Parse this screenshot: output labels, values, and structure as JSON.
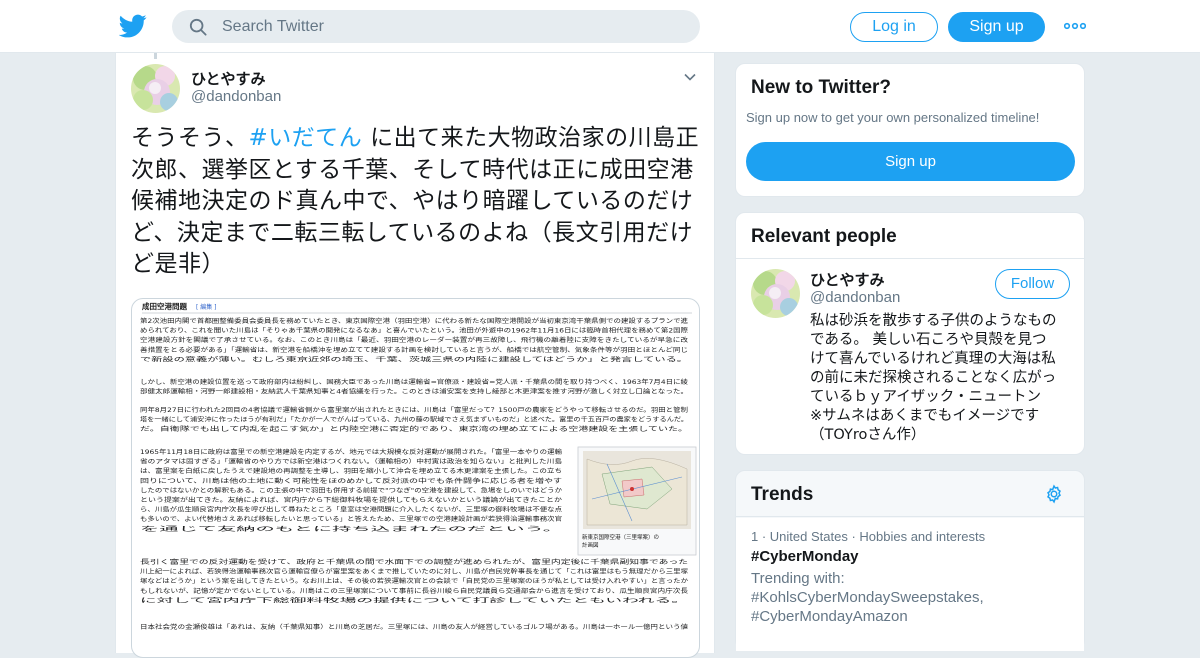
{
  "header": {
    "search_placeholder": "Search Twitter",
    "login_label": "Log in",
    "signup_label": "Sign up",
    "brand_color": "#1da1f2"
  },
  "tweet": {
    "user_name": "ひとやすみ",
    "user_handle": "@dandonban",
    "text_before": "そうそう、",
    "hashtag": "#いだてん",
    "text_after": " に出て来た大物政治家の川島正次郎、選挙区とする千葉、そして時代は正に成田空港候補地決定のド真ん中で、やはり暗躍しているのだけど、決定まで二転三転しているのよね（長文引用だけど是非）",
    "media": {
      "section_title": "成田空港問題",
      "edit_link": "[ 編集 ]",
      "map_caption_1": "新東京国際空港（三里塚案）の",
      "map_caption_2": "計画図",
      "lines_1": [
        "第2次池田内閣で首都圏整備委員会委員長を務めていたとき、東京国際空港（羽田空港）に代わる新たな国際空港開設が当初東京湾干葉県側での建設するプランで進",
        "められており、これを聞いた川島は「そりゃあ千葉県の開発になるなあ」と喜んでいたという。池田が外遊中の1962年11月16日には臨時首相代理を務めて第2国際",
        "空港建設方針を閣議で了承させている。なお、このとき川島は「最近、羽田空港のレーダー装置が再三故障し、飛行機の離着陸に支障をきたしているが早急に改",
        "善措置をとる必要がある」「運輸省は、新空港を船橋沖を埋め立てて建設する計画を検討していると言うが、船橋では航空管制、気象条件等が羽田とほとんど同じ",
        "で新設の意義が薄い。むしろ東京近郊の埼玉、千葉、茨城三県の内陸に建設してはどうか」と発言している。"
      ],
      "lines_2": [
        "しかし、新空港の建設位置を巡って政府部内は紛糾し、国務大臣であった川島は運輸省=官僚派・建設省=党人派・千葉県の間を取り持つべく、1963年7月4日に綾",
        "部健太郎運輸相・河野一郎建設相・友納武人千葉県知事と4者協議を行った。このときは浦安案を支持し綾部と木更津案を推す河野が激しく対立し口論となった。"
      ],
      "lines_3": [
        "同年8月27日に行われた2回目の4者協議で運輸省側から富里案が出されたときには、川島は「富里だって？1500戸の農家をどうやって移転させるのだ。羽田と管制",
        "塔を一緒にして浦安沖に作ったほうが有利だ」「たかが一人でがんばっている、九州の藤の駅域でさえ気まずいものだ」と述べた。富里の千五百戸の農家をどうするんだ。",
        "だ。自衛隊でも出して内乱を起こす気か」と内陸空港に否定的であり、東京湾の埋め立てによる空港建設を主張していた。"
      ],
      "lines_4": [
        "1965年11月18日に政府は富里での新空港建設を内定するが、地元では大規模な反対運動が展開された。「富里一本やりの運輸",
        "省のアタマは固すぎる」「運輸省のやり方では新空港はつくれない。（運輸相の）中村寅は政治を知らない」と批判した川島",
        "は、富里案を白紙に戻したうえで建設地の再調整を主導し、羽田を縮小して沖合を埋め立てる木更津案を主張した。この立ち",
        "回りについて、川島は他の土地に動く可能性をほのめかして反対派の中でも条件闘争に応じる者を増やす",
        "したのではないかとの解釈もある。この主張の中で羽田も併用する前提で\"つなぎ\"の空港を建設して、急場をしのいではどうか",
        "という提案が出てきた。友納によれば、宮内庁から下総御料牧場を提供してもらえないかという議論が出てきたことか",
        "ら、川島が瓜生順良宮内庁次長を呼び出して尋ねたところ「皇室は空港問題に介入したくないが、三里塚の御料牧場は不便な点",
        "も多いので、よい代替地さえあれば移転したいと思っている」と答えたため、三里塚での空港建設計画が若狭得治運輸事務次官",
        "を通じて友納のもとに持ち込まれたのだという。"
      ],
      "lines_5": [
        "長引く富里での反対運動を受けて、政府と千葉県の間で水面下での調整が進められたが、富里内定後に千葉県副知事であった",
        "川上紀一によれば、若狭得治運輸事務次官ら運輸官僚らが富里案をあくまで推していたのに対し、川島が自民党幹事長を通じて「これは富里はもう無理だから三里塚",
        "塚などはどうか」という案を出してきたという。なお川上は、その後の若狭運輸次官との会談で「自民党の三里塚案のほうが私としては受け入れやすい」と言ったか",
        "もしれないが、記憶が定かでないとしている。川島はこの三里塚案について事前に長谷川峻ら自民党議員ら交通部会から進言を受けており、瓜生順良宮内庁次長",
        "に対して宮内庁下総御料牧場の提供について打診していたともいわれる。"
      ],
      "lines_6": [
        "日本社会党の金瀬俊雄は「あれは、友納（千葉県知事）と川島の芝居だ。三里塚には、川島の友人が経営しているゴルフ場がある。川島は一ホール一億円という値"
      ]
    }
  },
  "new_to_twitter": {
    "title": "New to Twitter?",
    "subtitle": "Sign up now to get your own personalized timeline!",
    "signup_label": "Sign up"
  },
  "relevant_people": {
    "title": "Relevant people",
    "name": "ひとやすみ",
    "handle": "@dandonban",
    "follow_label": "Follow",
    "bio_lines": [
      "私は砂浜を散歩する子供のようなもの",
      "である。 美しい石ころや貝殻を見つ",
      "けて喜んでいるけれど真理の大海は私",
      "の前に未だ探検されることなく広がっ",
      "ているｂｙアイザック・ニュートン",
      "※サムネはあくまでもイメージです",
      "（TOYroさん作）"
    ]
  },
  "trends": {
    "title": "Trends",
    "item": {
      "meta": "1 · United States · Hobbies and interests",
      "name": "#CyberMonday",
      "with_lines": [
        "Trending with:",
        "#KohlsCyberMondaySweepstakes,",
        "#CyberMondayAmazon"
      ]
    }
  }
}
